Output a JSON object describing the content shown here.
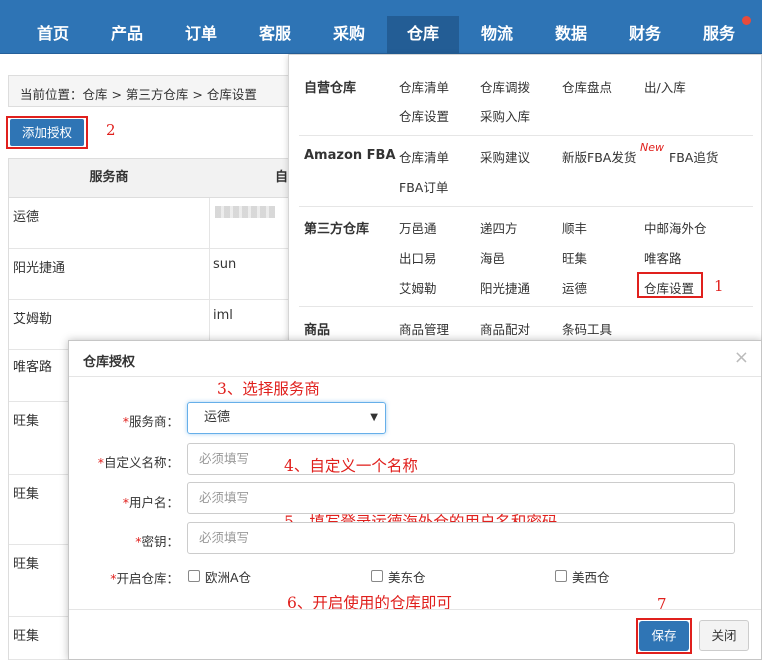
{
  "nav": {
    "items": [
      "首页",
      "产品",
      "订单",
      "客服",
      "采购",
      "仓库",
      "物流",
      "数据",
      "财务",
      "服务"
    ],
    "active": "仓库"
  },
  "page": {
    "breadcrumb": "当前位置：仓库 > 第三方仓库 > 仓库设置",
    "add_auth_label": "添加授权",
    "table": {
      "headers": [
        "服务商",
        "自"
      ],
      "rows": [
        {
          "provider": "运德",
          "user": ""
        },
        {
          "provider": "阳光捷通",
          "user": "sun"
        },
        {
          "provider": "艾姆勒",
          "user": "iml"
        },
        {
          "provider": "唯客路",
          "user": ""
        },
        {
          "provider": "旺集",
          "user": ""
        },
        {
          "provider": "旺集",
          "user": ""
        },
        {
          "provider": "旺集",
          "user": ""
        },
        {
          "provider": "旺集",
          "user": ""
        }
      ]
    }
  },
  "dropdown": {
    "groups": [
      {
        "title": "自营仓库",
        "links": [
          "仓库清单",
          "仓库调拨",
          "仓库盘点",
          "出/入库",
          "仓库设置",
          "采购入库"
        ]
      },
      {
        "title": "Amazon FBA",
        "links": [
          "仓库清单",
          "采购建议",
          "新版FBA发货",
          "FBA追货",
          "FBA订单"
        ],
        "new_tag": "New"
      },
      {
        "title": "第三方仓库",
        "links": [
          "万邑通",
          "递四方",
          "顺丰",
          "中邮海外仓",
          "出口易",
          "海邑",
          "旺集",
          "唯客路",
          "艾姆勒",
          "阳光捷通",
          "运德",
          "仓库设置"
        ]
      },
      {
        "title": "商品",
        "links": [
          "商品管理",
          "商品配对",
          "条码工具"
        ]
      }
    ]
  },
  "modal": {
    "title": "仓库授权",
    "close": "×",
    "fields": {
      "provider_label": "服务商：",
      "provider_value": "运德",
      "name_label": "自定义名称：",
      "name_placeholder": "必须填写",
      "user_label": "用户名：",
      "user_placeholder": "必须填写",
      "key_label": "密钥：",
      "key_placeholder": "必须填写",
      "warehouse_label": "开启仓库：",
      "warehouses": [
        "欧洲A仓",
        "美东仓",
        "美西仓"
      ]
    },
    "save_label": "保存",
    "close_label": "关闭"
  },
  "annotations": {
    "n1": "1",
    "n2": "2",
    "n3": "3、选择服务商",
    "n4": "4、自定义一个名称",
    "n5": "5、填写登录运德海外仓的用户名和密码",
    "n6": "6、开启使用的仓库即可",
    "n7": "7"
  },
  "colors": {
    "nav_bg": "#2e74b5",
    "accent": "#2f75b5",
    "annotation_red": "#e0201d"
  }
}
